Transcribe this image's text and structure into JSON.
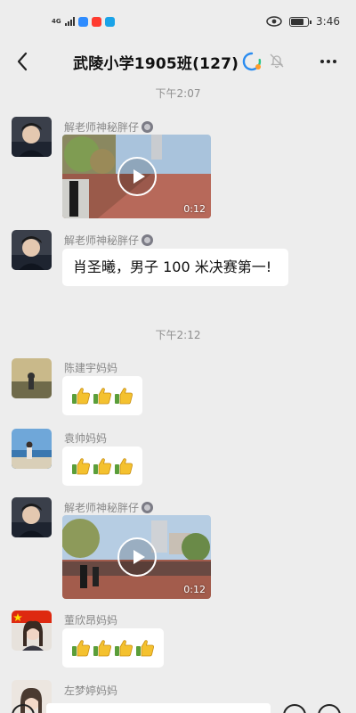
{
  "status_bar": {
    "network": "4G",
    "time": "3:46",
    "battery_level": 0.8
  },
  "nav": {
    "title": "武陵小学1905班(127)"
  },
  "messages": [
    {
      "type": "time",
      "text": "下午2:07"
    },
    {
      "type": "video",
      "sender": "解老师神秘胖仔",
      "duration": "0:12"
    },
    {
      "type": "text",
      "sender": "解老师神秘胖仔",
      "text": "肖圣曦，男子 100 米决赛第一!"
    },
    {
      "type": "time",
      "text": "下午2:12"
    },
    {
      "type": "emoji",
      "sender": "陈建宇妈妈",
      "emoji": "thumbs-up",
      "count": 3
    },
    {
      "type": "emoji",
      "sender": "袁帅妈妈",
      "emoji": "thumbs-up",
      "count": 3
    },
    {
      "type": "video",
      "sender": "解老师神秘胖仔",
      "duration": "0:12"
    },
    {
      "type": "emoji",
      "sender": "董欣昂妈妈",
      "emoji": "thumbs-up",
      "count": 4
    },
    {
      "type": "partial",
      "sender": "左梦婷妈妈"
    }
  ],
  "colors": {
    "background": "#ededed",
    "bubble": "#ffffff",
    "secondary_text": "#888888"
  }
}
